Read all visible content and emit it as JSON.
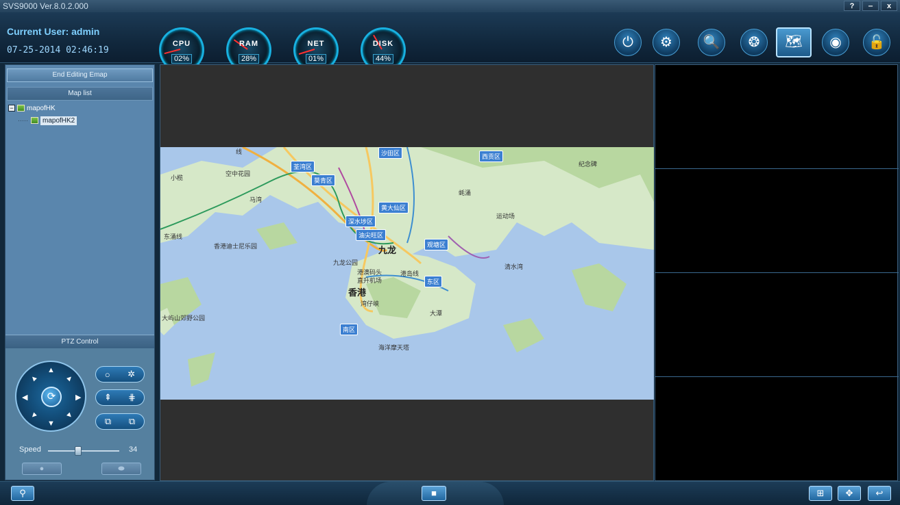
{
  "app": {
    "title": "SVS9000 Ver.8.0.2.000",
    "window_buttons": [
      "?",
      "‒",
      "x"
    ]
  },
  "header": {
    "current_user": "Current User: admin",
    "datetime": "07-25-2014 02:46:19",
    "gauges": [
      {
        "name": "CPU",
        "value": "02%"
      },
      {
        "name": "RAM",
        "value": "28%"
      },
      {
        "name": "NET",
        "value": "01%"
      },
      {
        "name": "DISK",
        "value": "44%"
      }
    ],
    "toolbar_icons": [
      "power-icon",
      "settings-icon",
      "search-playback-icon",
      "video-reel-icon",
      "emap-icon",
      "webcam-icon",
      "lock-icon"
    ]
  },
  "left_panel": {
    "end_editing_label": "End Editing Emap",
    "map_list_label": "Map list",
    "tree": [
      {
        "label": "mapofHK",
        "level": 0,
        "toggle": "−"
      },
      {
        "label": "mapofHK2",
        "level": 1
      }
    ],
    "ptz": {
      "title": "PTZ Control",
      "speed_label": "Speed",
      "speed_value": "34",
      "speed_fraction": 0.42
    }
  },
  "map": {
    "labels_boxed": [
      "沙田区",
      "西贡区",
      "荃湾区",
      "葵青区",
      "黄大仙区",
      "深水埗区",
      "油尖旺区",
      "观塘区",
      "东区",
      "南区"
    ],
    "labels_plain": [
      "小榄",
      "空中花园",
      "马湾",
      "东涌线",
      "香港迪士尼乐园",
      "蚝涌",
      "运动场",
      "纪念碑",
      "九龙公园",
      "港澳码头",
      "直升机场",
      "港岛线",
      "湾仔峡",
      "清水湾",
      "大潭",
      "大屿山郊野公园",
      "海洋摩天塔",
      "线"
    ],
    "labels_big": [
      "九龙",
      "香港"
    ]
  },
  "bottom_bar": {
    "left_icon": "search-icon",
    "center_icon": "camera-snapshot-icon",
    "right_icons": [
      "grid-layout-icon",
      "move-icon",
      "back-icon"
    ]
  }
}
